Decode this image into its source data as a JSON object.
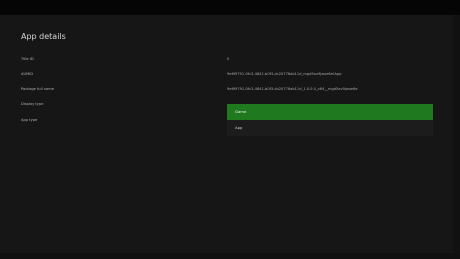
{
  "page": {
    "title": "App details"
  },
  "details": {
    "title_id_label": "Title ID",
    "title_id_value": "0",
    "aumid_label": "AUMID",
    "aumid_value": "9e6f9791-0fc3-4841-b0f3-cb20776ab11d_mgd5av9jwxe6e!App",
    "package_label": "Package full name",
    "package_value": "9e6f9791-0fc3-4841-b0f3-cb20776ab11d_1.0.0.0_x64__mgd5av9jwxe6e",
    "display_type_label": "Display type",
    "app_type_label": "App type"
  },
  "dropdown": {
    "options": [
      "Game",
      "App"
    ],
    "selected": "Game"
  },
  "colors": {
    "background": "#161616",
    "accent": "#1f7a1f"
  }
}
